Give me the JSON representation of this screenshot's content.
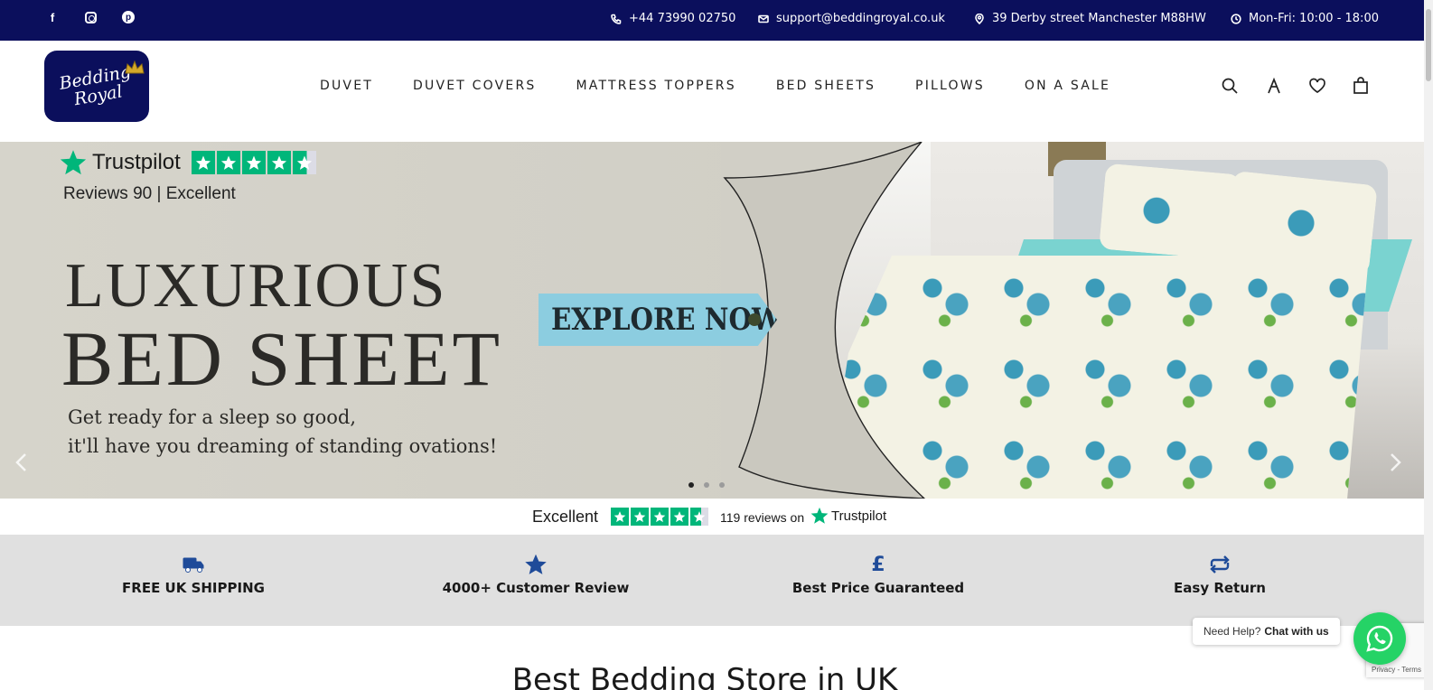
{
  "topbar": {
    "social": {
      "facebook": "f",
      "pinterest": "p"
    },
    "phone": "+44 73990 02750",
    "email": "support@beddingroyal.co.uk",
    "address": "39 Derby street Manchester M88HW",
    "hours": "Mon-Fri: 10:00 - 18:00"
  },
  "header": {
    "logo_line1": "Bedding",
    "logo_line2": "Royal",
    "nav": [
      "DUVET",
      "DUVET COVERS",
      "MATTRESS TOPPERS",
      "BED SHEETS",
      "PILLOWS",
      "ON A SALE"
    ],
    "icons": [
      "search-icon",
      "account-icon",
      "wishlist-icon",
      "cart-icon"
    ]
  },
  "hero": {
    "trustpilot_word": "Trustpilot",
    "reviews_line": "Reviews 90  |  Excellent",
    "headline1": "LUXURIOUS",
    "headline2": "BED SHEET",
    "sub1": "Get ready for a sleep so good,",
    "sub2": "it'll have you dreaming of standing ovations!",
    "cta": "EXPLORE NOW",
    "slides": 3,
    "active_slide": 1
  },
  "trust_strip": {
    "rating_word": "Excellent",
    "review_count": "119 reviews on",
    "brand": "Trustpilot",
    "colors": {
      "green": "#00b67a"
    }
  },
  "features": [
    {
      "icon": "truck-icon",
      "label": "FREE UK SHIPPING"
    },
    {
      "icon": "star-icon",
      "label": "4000+ Customer Review"
    },
    {
      "icon": "pound-icon",
      "label": "Best Price Guaranteed",
      "glyph": "£"
    },
    {
      "icon": "return-icon",
      "label": "Easy Return"
    }
  ],
  "section_heading": "Best Bedding Store in UK",
  "chat": {
    "prompt": "Need Help?",
    "action": "Chat with us"
  },
  "recaptcha": {
    "links": "Privacy - Terms"
  },
  "colors": {
    "navy": "#0b0f5c",
    "feature_blue": "#1f4b99",
    "whatsapp": "#25d366"
  }
}
